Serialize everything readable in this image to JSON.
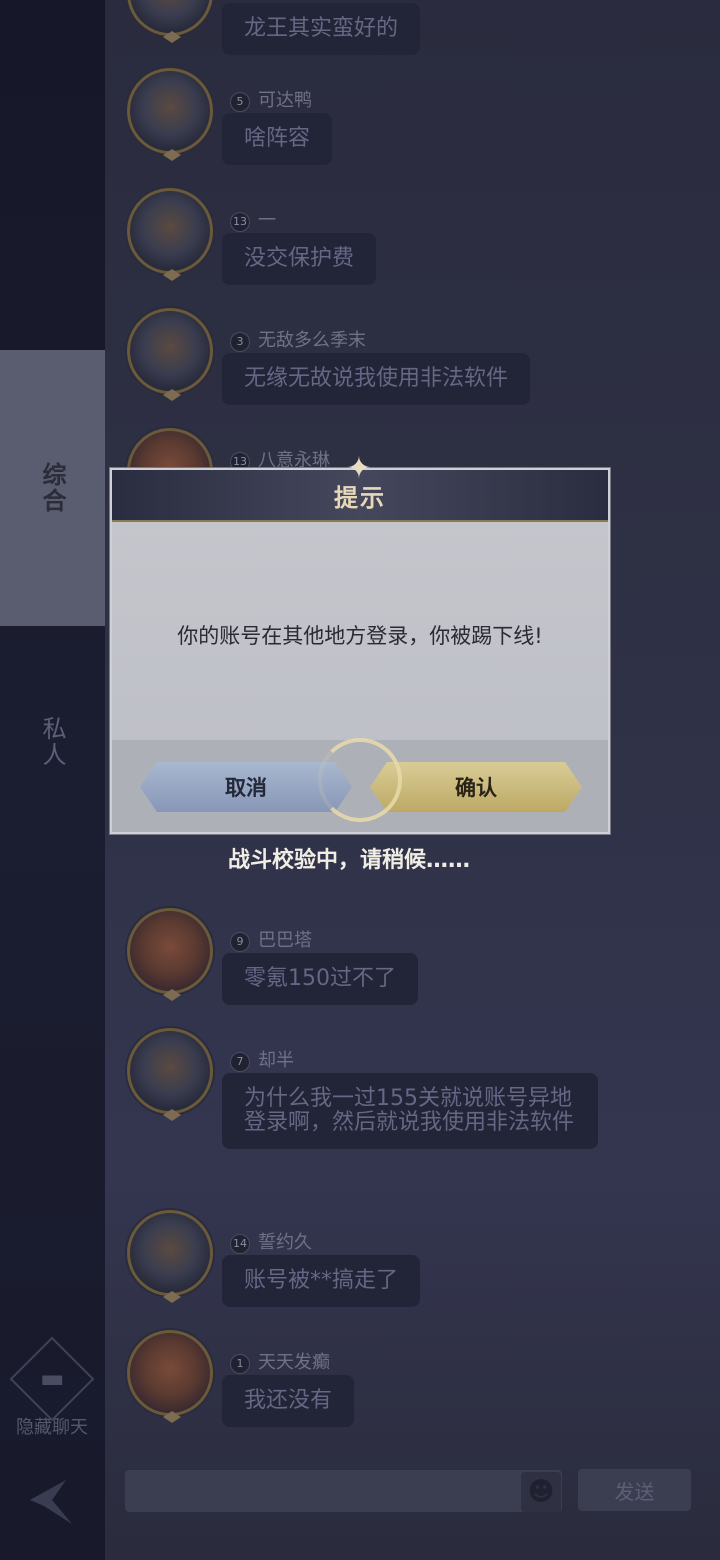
{
  "sidebar": {
    "tabs": [
      {
        "label": "综合"
      },
      {
        "label": "私人"
      }
    ],
    "hide_chat_label": "隐藏聊天"
  },
  "messages": [
    {
      "level": "",
      "username": "",
      "text": "龙王其实蛮好的",
      "avatar": "male-avatar"
    },
    {
      "level": "5",
      "username": "可达鸭",
      "text": "啥阵容",
      "avatar": "male-avatar"
    },
    {
      "level": "13",
      "username": "一",
      "text": "没交保护费",
      "avatar": "male-avatar"
    },
    {
      "level": "3",
      "username": "无敌多么季末",
      "text": "无缘无故说我使用非法软件",
      "avatar": "male-avatar"
    },
    {
      "level": "13",
      "username": "八意永琳",
      "text": "",
      "avatar": "redhead-avatar"
    },
    {
      "level": "9",
      "username": "巴巴塔",
      "text": "零氪150过不了",
      "avatar": "redhead-avatar"
    },
    {
      "level": "7",
      "username": "却半",
      "text": "为什么我一过155关就说账号异地登录啊，然后就说我使用非法软件",
      "avatar": "male-avatar"
    },
    {
      "level": "14",
      "username": "誓约久",
      "text": "账号被**搞走了",
      "avatar": "male-avatar"
    },
    {
      "level": "1",
      "username": "天天发癫",
      "text": "我还没有",
      "avatar": "redhead-avatar"
    }
  ],
  "input": {
    "send_label": "发送",
    "emoji_icon": "emoji-icon"
  },
  "dialog": {
    "title": "提示",
    "message": "你的账号在其他地方登录，你被踢下线!",
    "cancel_label": "取消",
    "confirm_label": "确认"
  },
  "loading": {
    "text": "战斗校验中，请稍候……"
  },
  "colors": {
    "accent_gold": "#bda964",
    "cancel_blue": "#8797b6",
    "sidebar_active": "#5a5c70"
  }
}
